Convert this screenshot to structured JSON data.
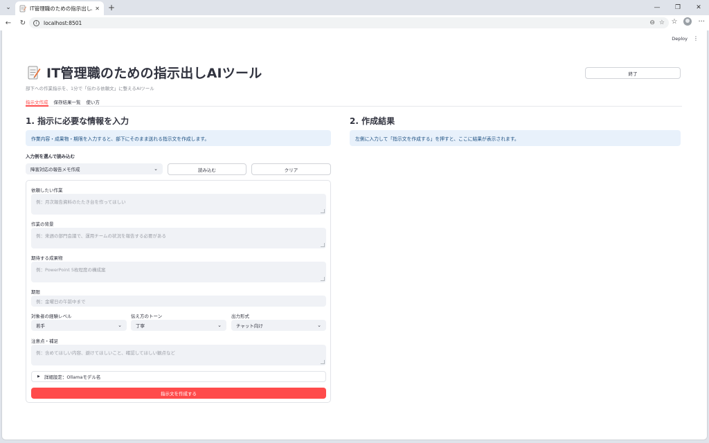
{
  "browser": {
    "tab_title": "IT管理職のための指示出しAIツール",
    "url": "localhost:8501"
  },
  "app": {
    "deploy_label": "Deploy",
    "title": "IT管理職のための指示出しAIツール",
    "subtitle": "部下への作業指示を、1分で「伝わる依頼文」に整えるAIツール",
    "quit_label": "終了",
    "tabs": [
      {
        "label": "指示文作成",
        "active": true
      },
      {
        "label": "保存結果一覧",
        "active": false
      },
      {
        "label": "使い方",
        "active": false
      }
    ]
  },
  "input_section": {
    "heading": "1. 指示に必要な情報を入力",
    "info": "作業内容・成果物・期限を入力すると、部下にそのまま送れる指示文を作成します。",
    "example_label": "入力例を選んで読み込む",
    "example_select": "障害対応の報告メモ作成",
    "load_button": "読み込む",
    "clear_button": "クリア",
    "fields": {
      "task_label": "依頼したい作業",
      "task_placeholder": "例：月次報告資料のたたき台を作ってほしい",
      "background_label": "作業の背景",
      "background_placeholder": "例：来週の部門会議で、運用チームの状況を報告する必要がある",
      "deliverable_label": "期待する成果物",
      "deliverable_placeholder": "例：PowerPoint 5枚程度の構成案",
      "deadline_label": "期限",
      "deadline_placeholder": "例：金曜日の午前中まで",
      "experience_label": "対象者の経験レベル",
      "experience_value": "若手",
      "tone_label": "伝え方のトーン",
      "tone_value": "丁寧",
      "format_label": "出力形式",
      "format_value": "チャット向け",
      "notes_label": "注意点・補足",
      "notes_placeholder": "例：含めてほしい内容、避けてほしいこと、確認してほしい観点など"
    },
    "advanced_label": "詳細設定：Ollamaモデル名",
    "submit_label": "指示文を作成する"
  },
  "result_section": {
    "heading": "2. 作成結果",
    "info": "左側に入力して「指示文を作成する」を押すと、ここに結果が表示されます。"
  },
  "colors": {
    "accent": "#ff4b4b",
    "info_bg": "#e8f1fb",
    "info_text": "#1c4f80"
  },
  "icons": {
    "title_icon": "memo-icon"
  }
}
